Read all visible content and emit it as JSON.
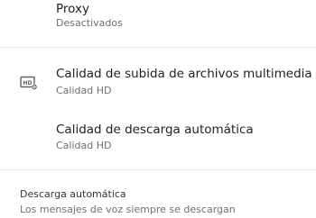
{
  "settings": {
    "proxy": {
      "title": "Proxy",
      "subtitle": "Desactivados"
    },
    "upload_quality": {
      "title": "Calidad de subida de archivos multimedia",
      "subtitle": "Calidad HD",
      "icon": "hd-settings-icon"
    },
    "auto_download_quality": {
      "title": "Calidad de descarga automática",
      "subtitle": "Calidad HD"
    }
  },
  "auto_download_section": {
    "header": "Descarga automática",
    "subtitle": "Los mensajes de voz siempre se descargan"
  }
}
